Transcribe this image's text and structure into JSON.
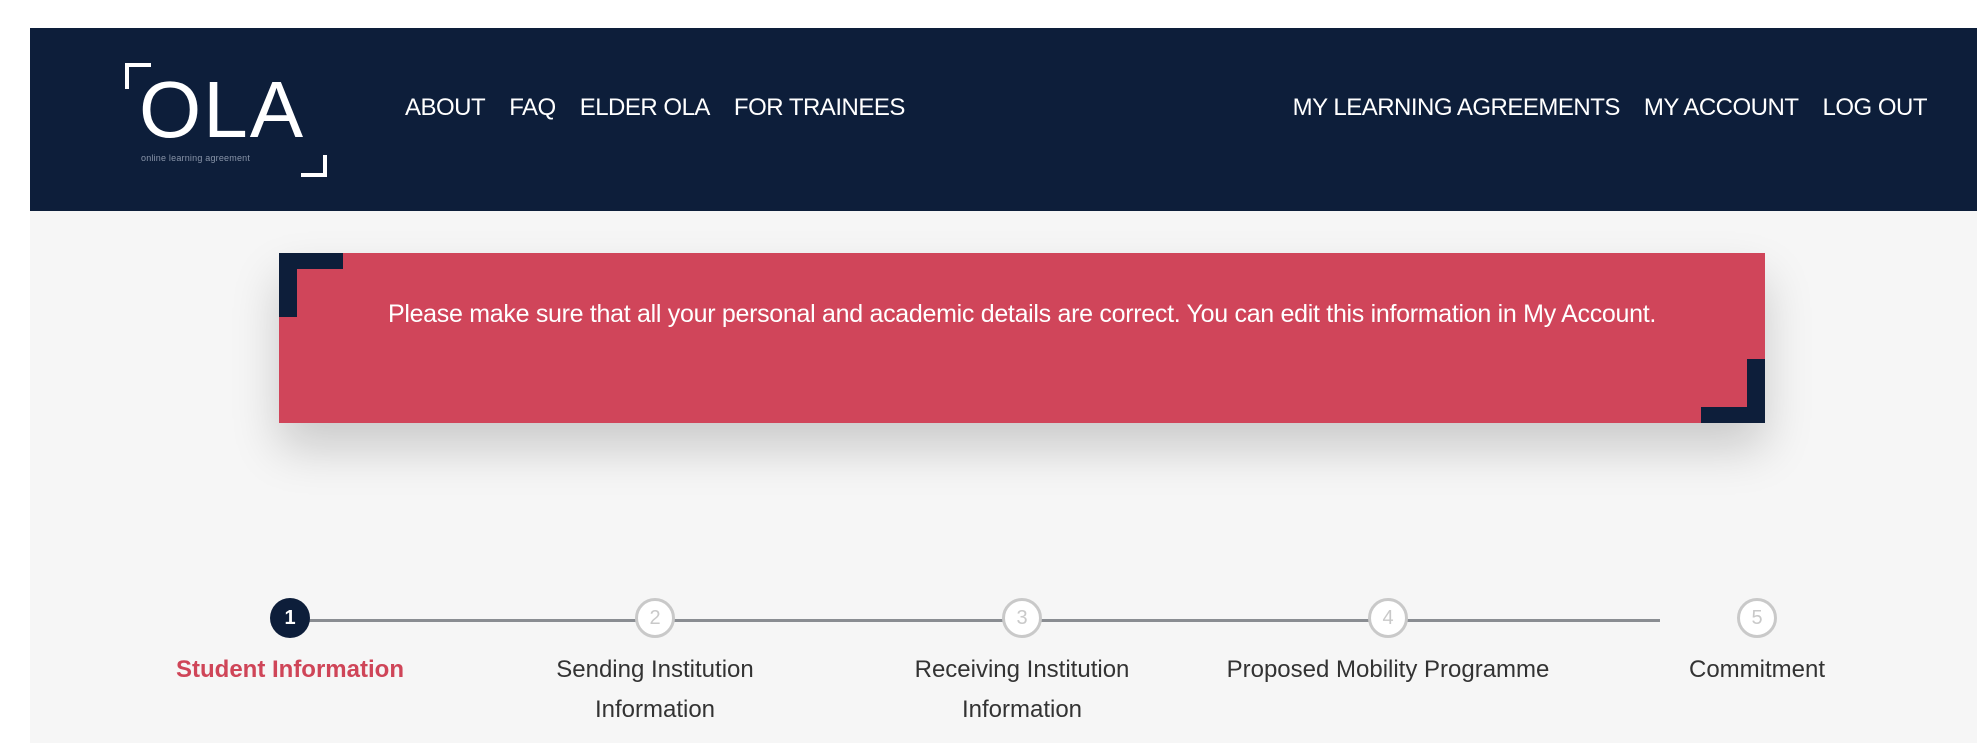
{
  "header": {
    "logo": {
      "text": "OLA",
      "tagline": "online learning agreement"
    },
    "nav_left": [
      "ABOUT",
      "FAQ",
      "ELDER OLA",
      "FOR TRAINEES"
    ],
    "nav_right": [
      "MY LEARNING AGREEMENTS",
      "MY ACCOUNT",
      "LOG OUT"
    ]
  },
  "alert": {
    "message": "Please make sure that all your personal and academic details are correct. You can edit this information in My Account."
  },
  "stepper": {
    "steps": [
      {
        "number": "1",
        "label": "Student Information",
        "active": true
      },
      {
        "number": "2",
        "label": "Sending Institution Information",
        "active": false
      },
      {
        "number": "3",
        "label": "Receiving Institution Information",
        "active": false
      },
      {
        "number": "4",
        "label": "Proposed Mobility Programme",
        "active": false
      },
      {
        "number": "5",
        "label": "Commitment",
        "active": false
      }
    ]
  },
  "colors": {
    "navy": "#0d1e3a",
    "accent_red": "#d0455a",
    "background": "#f6f6f6"
  }
}
